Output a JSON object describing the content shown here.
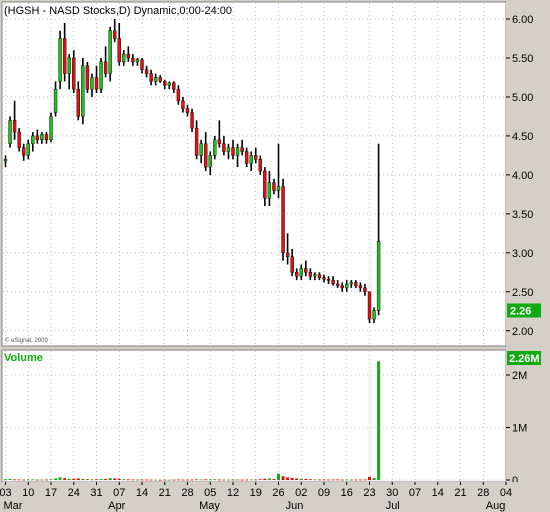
{
  "chart_data": {
    "type": "candlestick",
    "title": "(HGSH - NASD Stocks,D) Dynamic,0:00-24:00",
    "watermark": "© eSignal, 2009",
    "price_axis": {
      "ticks": [
        2.0,
        2.5,
        3.0,
        3.5,
        4.0,
        4.5,
        5.0,
        5.5,
        6.0
      ],
      "tick_labels": [
        "2.00",
        "2.50",
        "3.00",
        "3.50",
        "4.00",
        "4.50",
        "5.00",
        "5.50",
        "6.00"
      ],
      "ylim": [
        1.83,
        6.18
      ],
      "last_price": "2.26"
    },
    "volume_panel": {
      "label": "Volume",
      "last_volume_label": "2.26M",
      "tick_labels": [
        "2M",
        "1M",
        "0"
      ],
      "tick_values": [
        2000000,
        1000000,
        0
      ],
      "ylim": [
        0,
        2400000
      ]
    },
    "x_axis": {
      "day_labels": [
        "03",
        "10",
        "17",
        "24",
        "31",
        "07",
        "14",
        "21",
        "28",
        "05",
        "12",
        "19",
        "26",
        "02",
        "09",
        "16",
        "23",
        "30",
        "07",
        "14",
        "21",
        "28",
        "04"
      ],
      "day_label_bar_index": [
        0,
        5,
        10,
        15,
        20,
        25,
        30,
        35,
        40,
        45,
        50,
        55,
        60,
        65,
        70,
        75,
        80,
        85,
        90,
        95,
        100,
        105,
        110
      ],
      "month_labels": [
        "Mar",
        "Apr",
        "May",
        "Jun",
        "Jul",
        "Aug"
      ],
      "month_label_bar_index": [
        0,
        23,
        43,
        62,
        84,
        106
      ]
    },
    "colors": {
      "up": "#22bb22",
      "down": "#dd1111",
      "wick": "#000000",
      "volume": "#11aa11",
      "volume_label": "#11aa11",
      "last_price_bg": "#11aa11",
      "background": "#ffffff",
      "grid": "#9a9a9a",
      "frame": "#d4d0c8"
    },
    "ohlc": [
      [
        4.18,
        4.25,
        4.1,
        4.2
      ],
      [
        4.4,
        4.75,
        4.35,
        4.7
      ],
      [
        4.7,
        4.95,
        4.45,
        4.55
      ],
      [
        4.55,
        4.6,
        4.3,
        4.35
      ],
      [
        4.35,
        4.4,
        4.18,
        4.25
      ],
      [
        4.25,
        4.45,
        4.2,
        4.4
      ],
      [
        4.4,
        4.55,
        4.3,
        4.5
      ],
      [
        4.5,
        4.58,
        4.4,
        4.45
      ],
      [
        4.45,
        4.55,
        4.4,
        4.52
      ],
      [
        4.52,
        4.55,
        4.4,
        4.45
      ],
      [
        4.45,
        4.8,
        4.42,
        4.75
      ],
      [
        4.8,
        5.2,
        4.75,
        5.1
      ],
      [
        5.2,
        5.85,
        5.1,
        5.75
      ],
      [
        5.75,
        5.95,
        5.2,
        5.3
      ],
      [
        5.3,
        5.55,
        5.1,
        5.5
      ],
      [
        5.5,
        5.6,
        5.05,
        5.1
      ],
      [
        5.1,
        5.2,
        4.7,
        4.75
      ],
      [
        4.75,
        5.5,
        4.65,
        5.4
      ],
      [
        5.4,
        5.45,
        5.05,
        5.1
      ],
      [
        5.1,
        5.3,
        5.0,
        5.25
      ],
      [
        5.25,
        5.4,
        5.05,
        5.1
      ],
      [
        5.1,
        5.5,
        5.05,
        5.45
      ],
      [
        5.45,
        5.65,
        5.25,
        5.3
      ],
      [
        5.3,
        5.9,
        5.2,
        5.85
      ],
      [
        5.85,
        6.0,
        5.7,
        5.75
      ],
      [
        5.75,
        5.95,
        5.4,
        5.45
      ],
      [
        5.45,
        5.6,
        5.4,
        5.55
      ],
      [
        5.55,
        5.65,
        5.45,
        5.5
      ],
      [
        5.5,
        5.55,
        5.4,
        5.45
      ],
      [
        5.45,
        5.5,
        5.4,
        5.48
      ],
      [
        5.48,
        5.5,
        5.3,
        5.35
      ],
      [
        5.35,
        5.4,
        5.25,
        5.3
      ],
      [
        5.3,
        5.35,
        5.15,
        5.2
      ],
      [
        5.2,
        5.3,
        5.15,
        5.25
      ],
      [
        5.25,
        5.28,
        5.18,
        5.2
      ],
      [
        5.2,
        5.22,
        5.1,
        5.15
      ],
      [
        5.15,
        5.2,
        5.1,
        5.18
      ],
      [
        5.18,
        5.2,
        5.05,
        5.1
      ],
      [
        5.1,
        5.15,
        4.9,
        4.95
      ],
      [
        4.95,
        5.0,
        4.8,
        4.85
      ],
      [
        4.85,
        4.9,
        4.75,
        4.8
      ],
      [
        4.8,
        4.85,
        4.55,
        4.6
      ],
      [
        4.6,
        4.7,
        4.2,
        4.25
      ],
      [
        4.25,
        4.45,
        4.15,
        4.4
      ],
      [
        4.4,
        4.55,
        4.05,
        4.1
      ],
      [
        4.1,
        4.3,
        4.0,
        4.25
      ],
      [
        4.25,
        4.5,
        4.2,
        4.45
      ],
      [
        4.45,
        4.7,
        4.35,
        4.4
      ],
      [
        4.4,
        4.5,
        4.25,
        4.3
      ],
      [
        4.3,
        4.4,
        4.2,
        4.35
      ],
      [
        4.35,
        4.45,
        4.2,
        4.25
      ],
      [
        4.25,
        4.4,
        4.1,
        4.35
      ],
      [
        4.35,
        4.45,
        4.25,
        4.3
      ],
      [
        4.3,
        4.35,
        4.1,
        4.15
      ],
      [
        4.15,
        4.3,
        4.05,
        4.25
      ],
      [
        4.25,
        4.35,
        4.15,
        4.2
      ],
      [
        4.2,
        4.25,
        4.0,
        4.05
      ],
      [
        4.05,
        4.1,
        3.6,
        3.7
      ],
      [
        3.7,
        4.05,
        3.6,
        3.9
      ],
      [
        3.9,
        3.95,
        3.75,
        3.8
      ],
      [
        3.8,
        4.4,
        3.7,
        3.85
      ],
      [
        3.85,
        3.95,
        2.9,
        3.0
      ],
      [
        3.0,
        3.25,
        2.85,
        2.95
      ],
      [
        2.95,
        3.05,
        2.7,
        2.75
      ],
      [
        2.75,
        2.8,
        2.65,
        2.7
      ],
      [
        2.7,
        2.85,
        2.65,
        2.8
      ],
      [
        2.8,
        2.9,
        2.7,
        2.75
      ],
      [
        2.75,
        2.8,
        2.65,
        2.7
      ],
      [
        2.7,
        2.75,
        2.65,
        2.72
      ],
      [
        2.72,
        2.75,
        2.65,
        2.68
      ],
      [
        2.68,
        2.72,
        2.62,
        2.66
      ],
      [
        2.66,
        2.7,
        2.6,
        2.65
      ],
      [
        2.65,
        2.7,
        2.58,
        2.6
      ],
      [
        2.6,
        2.65,
        2.55,
        2.58
      ],
      [
        2.58,
        2.62,
        2.5,
        2.55
      ],
      [
        2.55,
        2.65,
        2.5,
        2.6
      ],
      [
        2.6,
        2.65,
        2.55,
        2.62
      ],
      [
        2.62,
        2.65,
        2.55,
        2.58
      ],
      [
        2.58,
        2.62,
        2.5,
        2.55
      ],
      [
        2.55,
        2.6,
        2.45,
        2.5
      ],
      [
        2.5,
        2.45,
        2.1,
        2.15
      ],
      [
        2.15,
        2.3,
        2.1,
        2.26
      ],
      [
        2.26,
        4.4,
        2.2,
        3.15
      ]
    ],
    "volume": [
      15000,
      20000,
      12000,
      10000,
      8000,
      9000,
      11000,
      7000,
      8000,
      9000,
      14000,
      30000,
      50000,
      35000,
      20000,
      25000,
      30000,
      22000,
      15000,
      12000,
      14000,
      18000,
      20000,
      35000,
      30000,
      25000,
      15000,
      12000,
      10000,
      8000,
      9000,
      8000,
      7000,
      6000,
      5000,
      6000,
      5000,
      7000,
      9000,
      8000,
      7000,
      8000,
      12000,
      10000,
      12000,
      10000,
      14000,
      9000,
      8000,
      7000,
      8000,
      9000,
      7000,
      8000,
      10000,
      9000,
      15000,
      25000,
      30000,
      18000,
      120000,
      70000,
      50000,
      40000,
      30000,
      25000,
      20000,
      15000,
      12000,
      10000,
      9000,
      8000,
      9000,
      10000,
      8000,
      9000,
      7000,
      8000,
      9000,
      10000,
      60000,
      40000,
      2260000
    ]
  }
}
